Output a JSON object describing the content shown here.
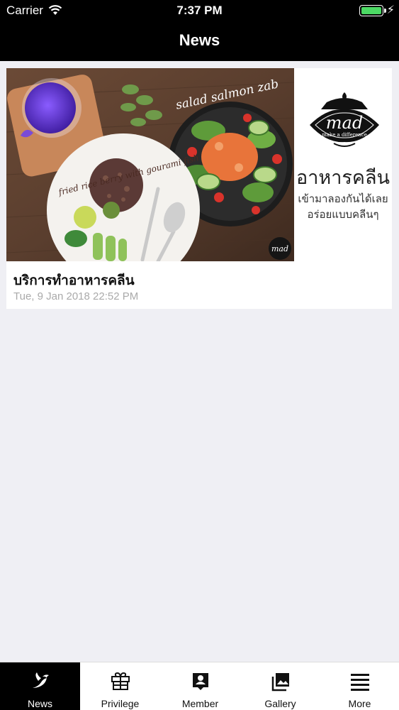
{
  "status_bar": {
    "carrier": "Carrier",
    "time": "7:37 PM",
    "battery_level": 1.0
  },
  "nav": {
    "title": "News"
  },
  "news": [
    {
      "title": "บริการทำอาหารคลีน",
      "date": "Tue, 9 Jan 2018 22:52 PM",
      "image": {
        "salad_caption": "salad salmon zab",
        "rice_caption": "fried rice berry with gourami fish",
        "logo_text": "mad",
        "logo_tagline": "make a difference",
        "headline": "อาหารคลีน",
        "subline_1": "เข้ามาลองกันได้เลย",
        "subline_2": "อร่อยแบบคลีนๆ"
      }
    }
  ],
  "tabs": [
    {
      "label": "News",
      "icon": "bird-icon",
      "active": true
    },
    {
      "label": "Privilege",
      "icon": "gift-icon",
      "active": false
    },
    {
      "label": "Member",
      "icon": "member-card-icon",
      "active": false
    },
    {
      "label": "Gallery",
      "icon": "gallery-icon",
      "active": false
    },
    {
      "label": "More",
      "icon": "menu-icon",
      "active": false
    }
  ]
}
